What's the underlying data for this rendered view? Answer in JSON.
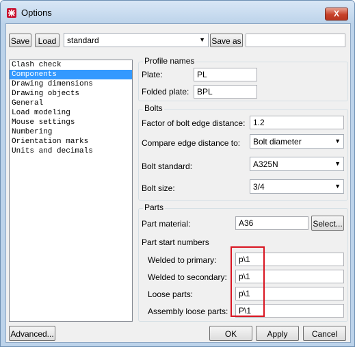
{
  "window": {
    "title": "Options",
    "close_label": "X"
  },
  "toolbar": {
    "save_label": "Save",
    "load_label": "Load",
    "preset_value": "standard",
    "save_as_label": "Save as",
    "save_as_value": ""
  },
  "categories": [
    "Clash check",
    "Components",
    "Drawing dimensions",
    "Drawing objects",
    "General",
    "Load modeling",
    "Mouse settings",
    "Numbering",
    "Orientation marks",
    "Units and decimals"
  ],
  "selected_category": "Components",
  "profile_names": {
    "title": "Profile names",
    "plate_label": "Plate:",
    "plate_value": "PL",
    "folded_plate_label": "Folded plate:",
    "folded_plate_value": "BPL"
  },
  "bolts": {
    "title": "Bolts",
    "edge_factor_label": "Factor of bolt edge distance:",
    "edge_factor_value": "1.2",
    "compare_label": "Compare edge distance to:",
    "compare_value": "Bolt diameter",
    "standard_label": "Bolt standard:",
    "standard_value": "A325N",
    "size_label": "Bolt size:",
    "size_value": "3/4"
  },
  "parts": {
    "title": "Parts",
    "material_label": "Part material:",
    "material_value": "A36",
    "select_label": "Select...",
    "start_numbers_label": "Part start numbers",
    "welded_primary_label": "Welded to primary:",
    "welded_primary_value": "p\\1",
    "welded_secondary_label": "Welded to secondary:",
    "welded_secondary_value": "p\\1",
    "loose_label": "Loose parts:",
    "loose_value": "p\\1",
    "assembly_loose_label": "Assembly loose parts:",
    "assembly_loose_value": "P\\1"
  },
  "footer": {
    "advanced_label": "Advanced...",
    "ok_label": "OK",
    "apply_label": "Apply",
    "cancel_label": "Cancel"
  },
  "colors": {
    "selection": "#3399ff",
    "highlight_box": "#d9131f"
  }
}
